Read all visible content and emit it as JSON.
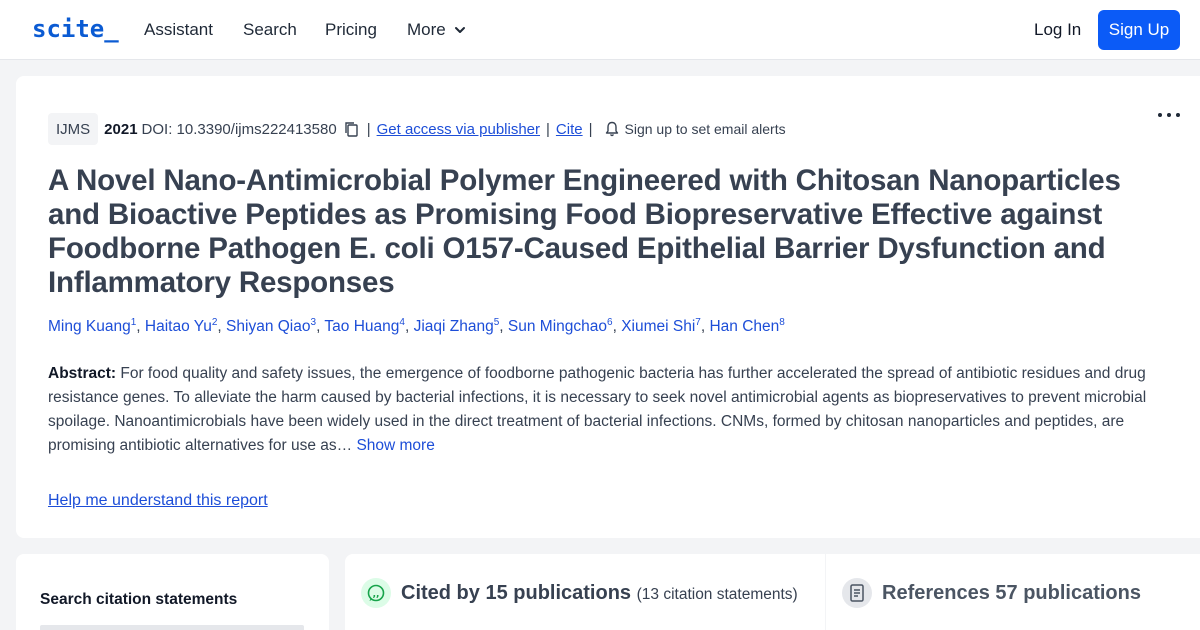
{
  "nav": {
    "logo": "scite_",
    "links": [
      "Assistant",
      "Search",
      "Pricing",
      "More"
    ],
    "login": "Log In",
    "signup": "Sign Up"
  },
  "meta": {
    "journal": "IJMS",
    "year": "2021",
    "doi": "DOI: 10.3390/ijms222413580",
    "publisher_link": "Get access via publisher",
    "cite_link": "Cite",
    "alerts": "Sign up to set email alerts"
  },
  "paper": {
    "title": "A Novel Nano-Antimicrobial Polymer Engineered with Chitosan Nanoparticles and Bioactive Peptides as Promising Food Biopreservative Effective against Foodborne Pathogen E. coli O157-Caused Epithelial Barrier Dysfunction and Inflammatory Responses",
    "authors": [
      {
        "name": "Ming Kuang",
        "num": "1"
      },
      {
        "name": "Haitao Yu",
        "num": "2"
      },
      {
        "name": "Shiyan Qiao",
        "num": "3"
      },
      {
        "name": "Tao Huang",
        "num": "4"
      },
      {
        "name": "Jiaqi Zhang",
        "num": "5"
      },
      {
        "name": "Sun Mingchao",
        "num": "6"
      },
      {
        "name": "Xiumei Shi",
        "num": "7"
      },
      {
        "name": "Han Chen",
        "num": "8"
      }
    ],
    "abstract_label": "Abstract:",
    "abstract_text": "For food quality and safety issues, the emergence of foodborne pathogenic bacteria has further accelerated the spread of antibiotic residues and drug resistance genes. To alleviate the harm caused by bacterial infections, it is necessary to seek novel antimicrobial agents as biopreservatives to prevent microbial spoilage. Nanoantimicrobials have been widely used in the direct treatment of bacterial infections. CNMs, formed by chitosan nanoparticles and peptides, are promising antibiotic alternatives for use as…",
    "show_more": "Show more",
    "help_link": "Help me understand this report"
  },
  "bottom": {
    "search_title": "Search citation statements",
    "cited_title": "Cited by 15 publications",
    "cited_sub": "(13 citation statements)",
    "refs_title": "References 57 publications"
  },
  "colors": {
    "brand": "#0b5bd3",
    "link": "#1d4ed8",
    "signup_bg": "#0b5bf7"
  }
}
